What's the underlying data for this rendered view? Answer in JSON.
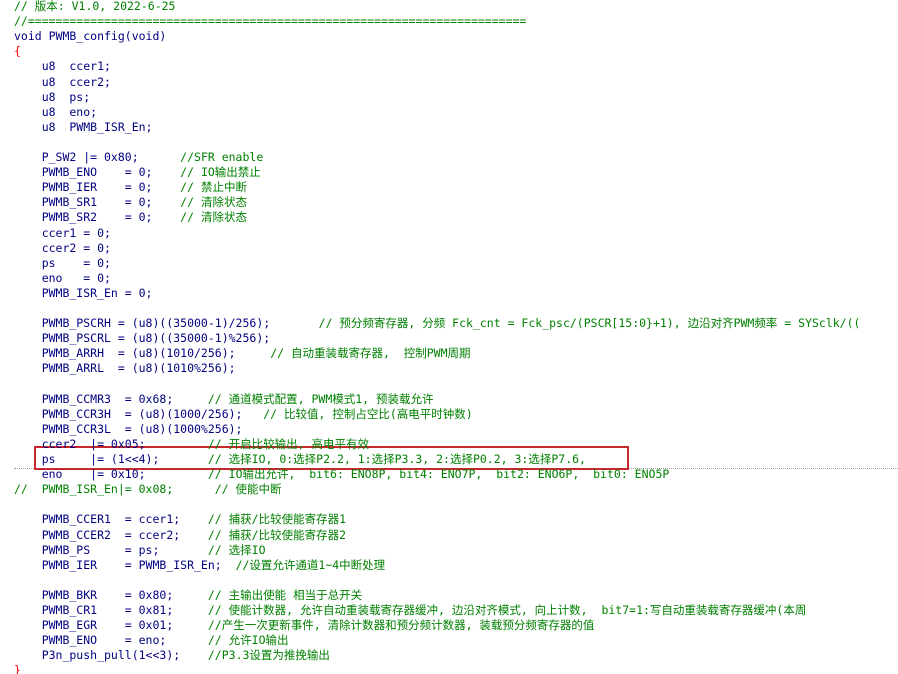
{
  "colors": {
    "code": "#000080",
    "comment": "#008000",
    "keyword": "#00008b",
    "highlight_box": "#c8282d",
    "brace": "#ff0000"
  },
  "lines": [
    {
      "y": 0,
      "text": "// 版本: V1.0, 2022-6-25",
      "kind": "comment"
    },
    {
      "y": 1,
      "text": "//========================================================================",
      "kind": "comment"
    },
    {
      "y": 2,
      "text": "void PWMB_config(void)",
      "kind": "code"
    },
    {
      "y": 3,
      "text": "{",
      "kind": "brace"
    },
    {
      "y": 4,
      "text": "    u8  ccer1;",
      "kind": "code"
    },
    {
      "y": 5,
      "text": "    u8  ccer2;",
      "kind": "code"
    },
    {
      "y": 6,
      "text": "    u8  ps;",
      "kind": "code"
    },
    {
      "y": 7,
      "text": "    u8  eno;",
      "kind": "code"
    },
    {
      "y": 8,
      "text": "    u8  PWMB_ISR_En;",
      "kind": "code"
    },
    {
      "y": 9,
      "text": "",
      "kind": "code"
    },
    {
      "y": 10,
      "code": "    P_SW2 |= 0x80;      ",
      "comment": "//SFR enable"
    },
    {
      "y": 11,
      "code": "    PWMB_ENO    = 0;    ",
      "comment": "// IO输出禁止"
    },
    {
      "y": 12,
      "code": "    PWMB_IER    = 0;    ",
      "comment": "// 禁止中断"
    },
    {
      "y": 13,
      "code": "    PWMB_SR1    = 0;    ",
      "comment": "// 清除状态"
    },
    {
      "y": 14,
      "code": "    PWMB_SR2    = 0;    ",
      "comment": "// 清除状态"
    },
    {
      "y": 15,
      "text": "    ccer1 = 0;",
      "kind": "code"
    },
    {
      "y": 16,
      "text": "    ccer2 = 0;",
      "kind": "code"
    },
    {
      "y": 17,
      "text": "    ps    = 0;",
      "kind": "code"
    },
    {
      "y": 18,
      "text": "    eno   = 0;",
      "kind": "code"
    },
    {
      "y": 19,
      "text": "    PWMB_ISR_En = 0;",
      "kind": "code"
    },
    {
      "y": 20,
      "text": "",
      "kind": "code"
    },
    {
      "y": 21,
      "code": "    PWMB_PSCRH = (u8)((35000-1)/256);       ",
      "comment": "// 预分频寄存器, 分频 Fck_cnt = Fck_psc/(PSCR[15:0}+1), 边沿对齐PWM频率 = SYSclk/(("
    },
    {
      "y": 22,
      "text": "    PWMB_PSCRL = (u8)((35000-1)%256);",
      "kind": "code"
    },
    {
      "y": 23,
      "code": "    PWMB_ARRH  = (u8)(1010/256);     ",
      "comment": "// 自动重装载寄存器,  控制PWM周期"
    },
    {
      "y": 24,
      "text": "    PWMB_ARRL  = (u8)(1010%256);",
      "kind": "code"
    },
    {
      "y": 25,
      "text": "",
      "kind": "code"
    },
    {
      "y": 26,
      "code": "    PWMB_CCMR3  = 0x68;     ",
      "comment": "// 通道模式配置, PWM模式1, 预装载允许"
    },
    {
      "y": 27,
      "code": "    PWMB_CCR3H  = (u8)(1000/256);   ",
      "comment": "// 比较值, 控制占空比(高电平时钟数)"
    },
    {
      "y": 28,
      "text": "    PWMB_CCR3L  = (u8)(1000%256);",
      "kind": "code"
    },
    {
      "y": 29,
      "code": "    ccer2  |= 0x05;         ",
      "comment": "// 开启比较输出, 高电平有效"
    },
    {
      "y": 30,
      "code": "    ps     |= (1<<4);       ",
      "comment": "// 选择IO, 0:选择P2.2, 1:选择P3.3, 2:选择P0.2, 3:选择P7.6,"
    },
    {
      "y": 31,
      "code": "    eno    |= 0x10;         ",
      "comment": "// IO输出允许,  bit6: ENO8P, bit4: ENO7P,  bit2: ENO6P,  bit0: ENO5P"
    },
    {
      "y": 32,
      "text": "//  PWMB_ISR_En|= 0x08;      // 使能中断",
      "kind": "comment"
    },
    {
      "y": 33,
      "text": "",
      "kind": "code"
    },
    {
      "y": 34,
      "code": "    PWMB_CCER1  = ccer1;    ",
      "comment": "// 捕获/比较使能寄存器1"
    },
    {
      "y": 35,
      "code": "    PWMB_CCER2  = ccer2;    ",
      "comment": "// 捕获/比较使能寄存器2"
    },
    {
      "y": 36,
      "code": "    PWMB_PS     = ps;       ",
      "comment": "// 选择IO"
    },
    {
      "y": 37,
      "code": "    PWMB_IER    = PWMB_ISR_En;  ",
      "comment": "//设置允许通道1~4中断处理"
    },
    {
      "y": 38,
      "text": "",
      "kind": "code"
    },
    {
      "y": 39,
      "code": "    PWMB_BKR    = 0x80;     ",
      "comment": "// 主输出使能 相当于总开关"
    },
    {
      "y": 40,
      "code": "    PWMB_CR1    = 0x81;     ",
      "comment": "// 使能计数器, 允许自动重装载寄存器缓冲, 边沿对齐模式, 向上计数,  bit7=1:写自动重装载寄存器缓冲(本周"
    },
    {
      "y": 41,
      "code": "    PWMB_EGR    = 0x01;     ",
      "comment": "//产生一次更新事件, 清除计数器和预分频计数器, 装载预分频寄存器的值"
    },
    {
      "y": 42,
      "code": "    PWMB_ENO    = eno;      ",
      "comment": "// 允许IO输出"
    },
    {
      "y": 43,
      "code": "    P3n_push_pull(1<<3);    ",
      "comment": "//P3.3设置为推挽输出"
    },
    {
      "y": 44,
      "text": "}",
      "kind": "brace"
    }
  ]
}
